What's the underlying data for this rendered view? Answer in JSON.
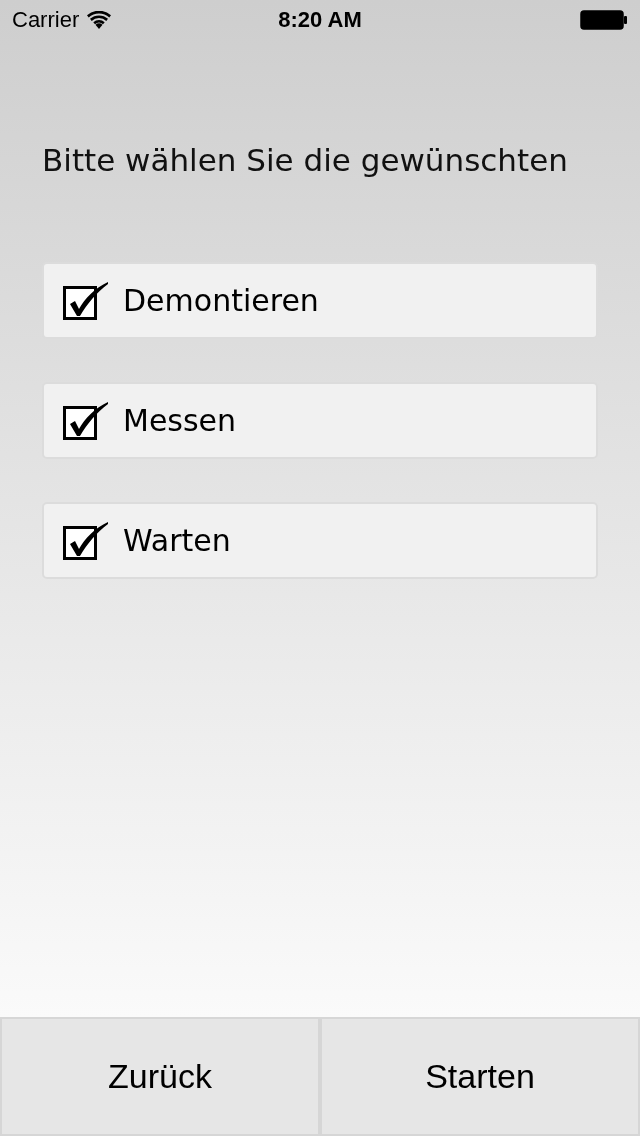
{
  "status_bar": {
    "carrier": "Carrier",
    "time": "8:20 AM"
  },
  "prompt": "Bitte wählen Sie die gewünschten",
  "options": [
    {
      "label": "Demontieren",
      "checked": true
    },
    {
      "label": "Messen",
      "checked": true
    },
    {
      "label": "Warten",
      "checked": true
    }
  ],
  "buttons": [
    {
      "label": "Zurück"
    },
    {
      "label": "Starten"
    }
  ]
}
